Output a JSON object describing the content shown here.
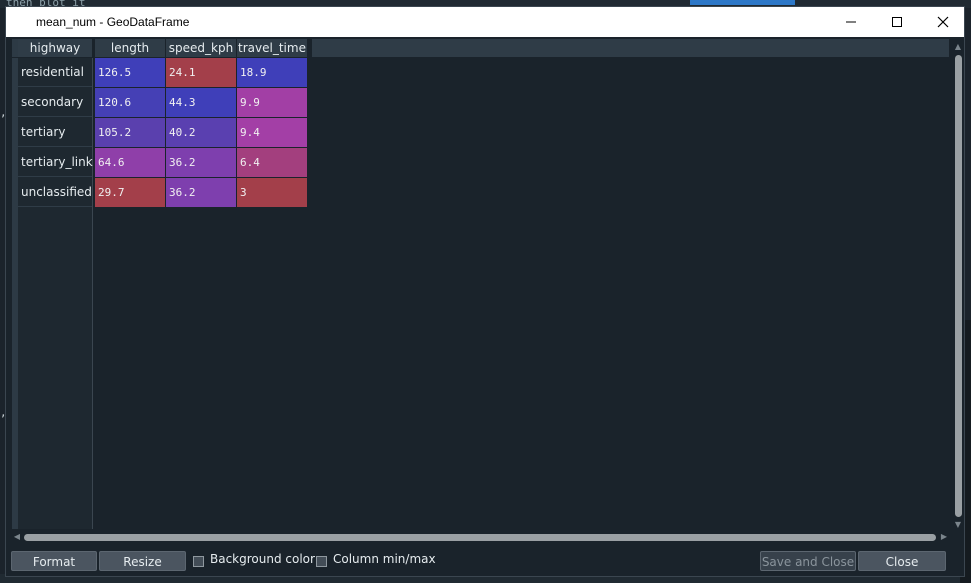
{
  "window": {
    "title": "mean_num - GeoDataFrame"
  },
  "background": {
    "top_text": "then plot it"
  },
  "table": {
    "index_header": "highway",
    "columns": [
      "length",
      "speed_kph",
      "travel_time"
    ],
    "rows": [
      {
        "index": "residential",
        "values": [
          "126.5",
          "24.1",
          "18.9"
        ],
        "colors": [
          "#3f3fb9",
          "#a33f4a",
          "#3f3fb9"
        ]
      },
      {
        "index": "secondary",
        "values": [
          "120.6",
          "44.3",
          "9.9"
        ],
        "colors": [
          "#4540b5",
          "#3f3fb9",
          "#a23fa5"
        ]
      },
      {
        "index": "tertiary",
        "values": [
          "105.2",
          "40.2",
          "9.4"
        ],
        "colors": [
          "#5a40ae",
          "#5a40b0",
          "#a33fa6"
        ]
      },
      {
        "index": "tertiary_link",
        "values": [
          "64.6",
          "36.2",
          "6.4"
        ],
        "colors": [
          "#8f3fa9",
          "#7e3fae",
          "#a33f7e"
        ]
      },
      {
        "index": "unclassified",
        "values": [
          "29.7",
          "36.2",
          "3"
        ],
        "colors": [
          "#a33f4a",
          "#7e3fae",
          "#a33f4a"
        ]
      }
    ]
  },
  "bottom": {
    "format_label": "Format",
    "resize_label": "Resize",
    "background_color_label": "Background color",
    "column_minmax_label": "Column min/max",
    "save_close_label": "Save and Close",
    "close_label": "Close"
  }
}
